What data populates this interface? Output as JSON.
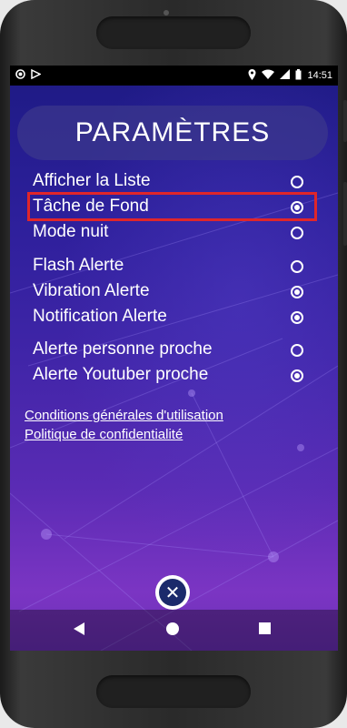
{
  "statusbar": {
    "time": "14:51",
    "icons_left": [
      "record-icon",
      "play-store-icon"
    ],
    "icons_right": [
      "location-icon",
      "wifi-icon",
      "signal-icon",
      "battery-icon"
    ]
  },
  "header": {
    "title": "PARAMÈTRES"
  },
  "settings": [
    {
      "label": "Afficher la Liste",
      "checked": false
    },
    {
      "label": "Tâche de Fond",
      "checked": true,
      "highlighted": true
    },
    {
      "label": "Mode nuit",
      "checked": false
    },
    {
      "label": "Flash Alerte",
      "checked": false
    },
    {
      "label": "Vibration Alerte",
      "checked": true
    },
    {
      "label": "Notification Alerte",
      "checked": true
    },
    {
      "label": "Alerte personne proche",
      "checked": false
    },
    {
      "label": "Alerte Youtuber proche",
      "checked": true
    }
  ],
  "links": {
    "terms": "Conditions générales d'utilisation",
    "privacy": "Politique de confidentialité"
  },
  "colors": {
    "highlight": "#e0262a",
    "close_button": "#1b2a6b"
  },
  "icons": {
    "close": "close-icon"
  }
}
